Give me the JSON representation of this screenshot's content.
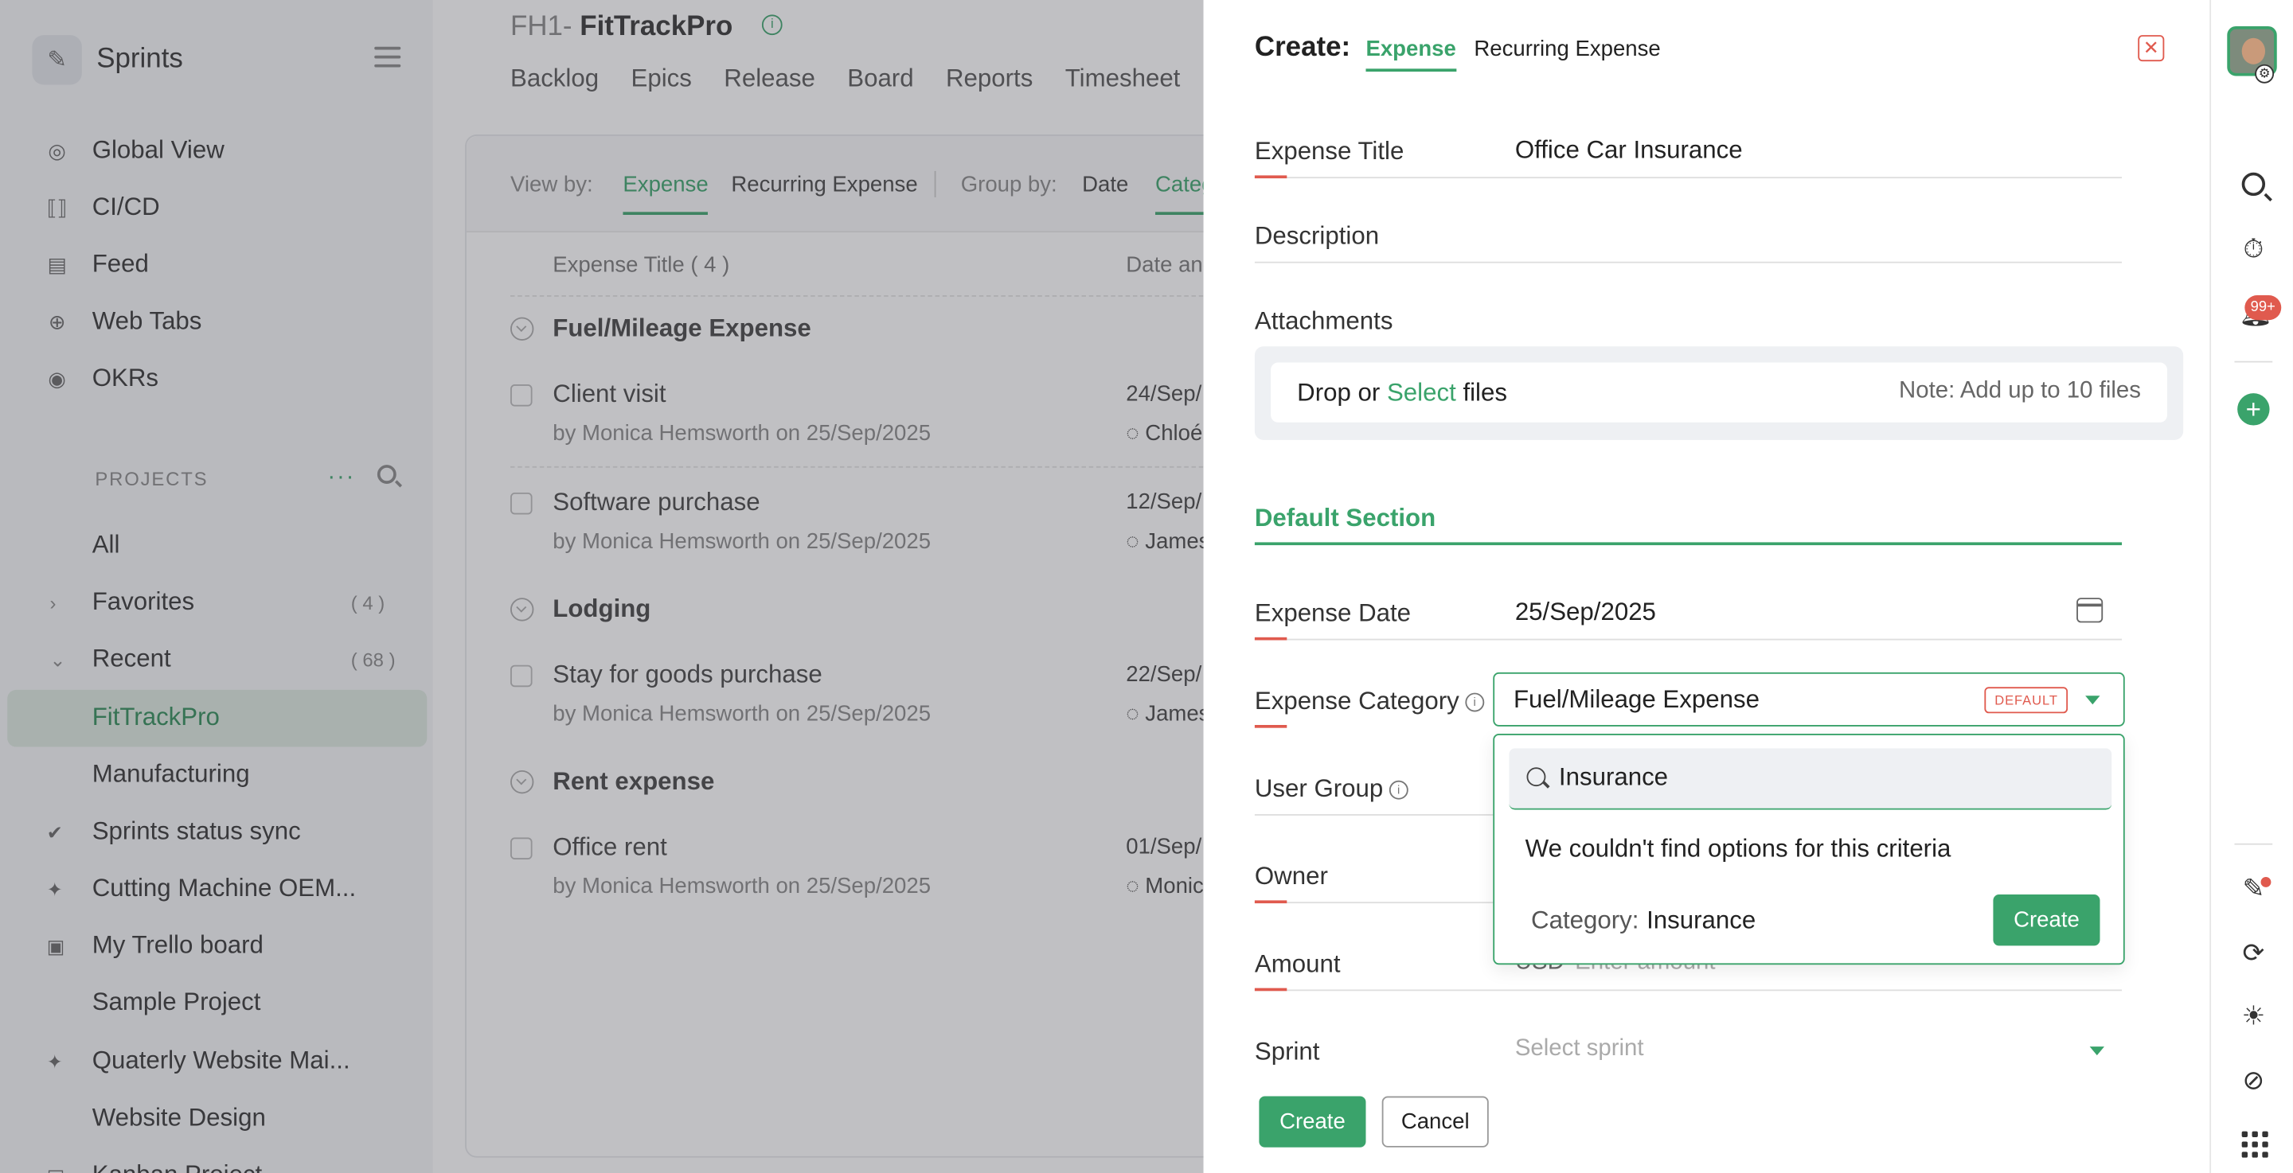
{
  "sidebar": {
    "app_name": "Sprints",
    "nav": [
      {
        "label": "Global View",
        "icon": "globe-view-icon"
      },
      {
        "label": "CI/CD",
        "icon": "cicd-icon"
      },
      {
        "label": "Feed",
        "icon": "feed-icon"
      },
      {
        "label": "Web Tabs",
        "icon": "web-tabs-icon"
      },
      {
        "label": "OKRs",
        "icon": "okrs-icon"
      }
    ],
    "projects_header": "PROJECTS",
    "projects": {
      "all": "All",
      "favorites": "Favorites",
      "favorites_count": "( 4 )",
      "recent": "Recent",
      "recent_count": "( 68 )",
      "items": [
        "FitTrackPro",
        "Manufacturing",
        "Sprints status sync",
        "Cutting Machine OEM...",
        "My Trello board",
        "Sample Project",
        "Quaterly Website Mai...",
        "Website Design",
        "Kanban Project"
      ]
    }
  },
  "main": {
    "project_prefix": "FH1-",
    "project_name": "FitTrackPro",
    "tabs": [
      "Backlog",
      "Epics",
      "Release",
      "Board",
      "Reports",
      "Timesheet"
    ],
    "view_by_label": "View by:",
    "view_expense": "Expense",
    "view_recurring": "Recurring Expense",
    "group_by_label": "Group by:",
    "group_date": "Date",
    "group_category": "Category",
    "col_title": "Expense Title ( 4 )",
    "col_date": "Date and",
    "groups": [
      {
        "name": "Fuel/Mileage Expense",
        "rows": [
          {
            "title": "Client visit",
            "by": "by Monica Hemsworth on 25/Sep/2025",
            "date": "24/Sep/",
            "user": "Chloé"
          },
          {
            "title": "Software purchase",
            "by": "by Monica Hemsworth on 25/Sep/2025",
            "date": "12/Sep/",
            "user": "James"
          }
        ]
      },
      {
        "name": "Lodging",
        "rows": [
          {
            "title": "Stay for goods purchase",
            "by": "by Monica Hemsworth on 25/Sep/2025",
            "date": "22/Sep/",
            "user": "James"
          }
        ]
      },
      {
        "name": "Rent expense",
        "rows": [
          {
            "title": "Office rent",
            "by": "by Monica Hemsworth on 25/Sep/2025",
            "date": "01/Sep/",
            "user": "Monic"
          }
        ]
      }
    ]
  },
  "modal": {
    "title": "Create:",
    "tab_expense": "Expense",
    "tab_recurring": "Recurring Expense",
    "fields": {
      "expense_title_label": "Expense Title",
      "expense_title_value": "Office Car Insurance",
      "description_label": "Description",
      "attachments_label": "Attachments",
      "drop_text": "Drop or",
      "select_text": "Select",
      "files_text": "files",
      "attach_note": "Note: Add up to 10 files",
      "section_title": "Default Section",
      "expense_date_label": "Expense Date",
      "expense_date_value": "25/Sep/2025",
      "expense_category_label": "Expense Category",
      "expense_category_value": "Fuel/Mileage Expense",
      "default_badge": "DEFAULT",
      "user_group_label": "User Group",
      "owner_label": "Owner",
      "amount_label": "Amount",
      "currency": "USD",
      "amount_placeholder": "Enter amount",
      "sprint_label": "Sprint",
      "sprint_placeholder": "Select sprint"
    },
    "dropdown": {
      "search_value": "Insurance",
      "empty_message": "We couldn't find options for this criteria",
      "category_prefix": "Category:",
      "category_value": "Insurance",
      "create_label": "Create"
    },
    "create_label": "Create",
    "cancel_label": "Cancel"
  },
  "rail": {
    "notification_badge": "99+"
  },
  "colors": {
    "accent": "#3aa36b",
    "danger": "#e05a4e"
  }
}
